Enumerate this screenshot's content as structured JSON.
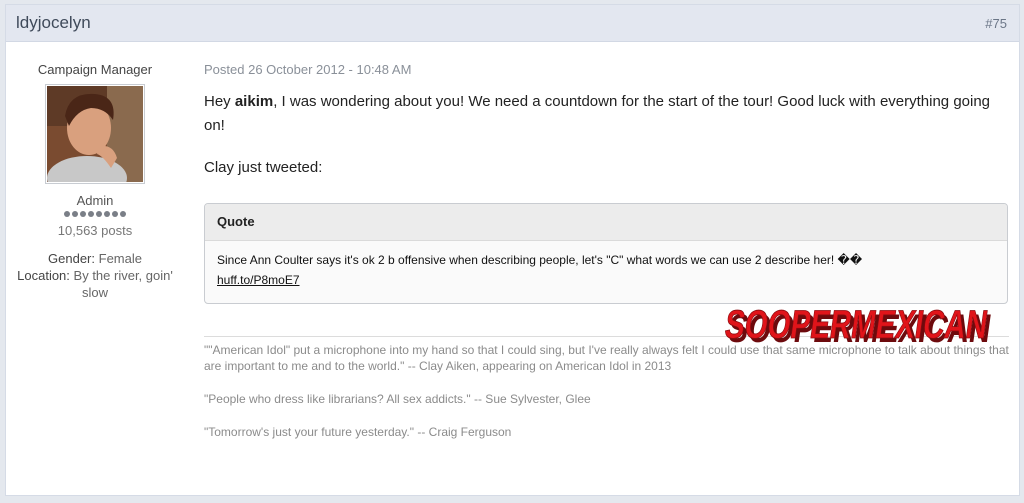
{
  "post": {
    "username": "ldyjocelyn",
    "number": "#75",
    "member_title": "Campaign Manager",
    "group": "Admin",
    "rank_pips": 8,
    "post_count": "10,563 posts",
    "gender_label": "Gender:",
    "gender_value": "Female",
    "location_label": "Location:",
    "location_value": "By the river, goin' slow",
    "posted": "Posted 26 October 2012 - 10:48 AM",
    "body": {
      "greeting": "Hey ",
      "mention": "aikim",
      "text": ", I was wondering about you!  We need a countdown for the start of the tour!  Good luck with everything going on!",
      "line2": "Clay just tweeted:"
    },
    "quote": {
      "title": "Quote",
      "text": "Since Ann Coulter says it's ok 2 b offensive when describing people, let's \"C\" what words we can use 2 describe her! ��",
      "link": "huff.to/P8moE7"
    },
    "signature": [
      "\"\"American Idol\" put a microphone into my hand so that I could sing, but I've really always felt I could use that same microphone to talk about things that are important to me and to the world.\" -- Clay Aiken, appearing on American Idol in 2013",
      "\"People who dress like librarians? All sex addicts.\" -- Sue Sylvester, Glee",
      "\"Tomorrow's just your future yesterday.\" -- Craig Ferguson"
    ]
  },
  "watermark": {
    "text": "SOOPERMEXICAN",
    "color": "#e0141a"
  }
}
